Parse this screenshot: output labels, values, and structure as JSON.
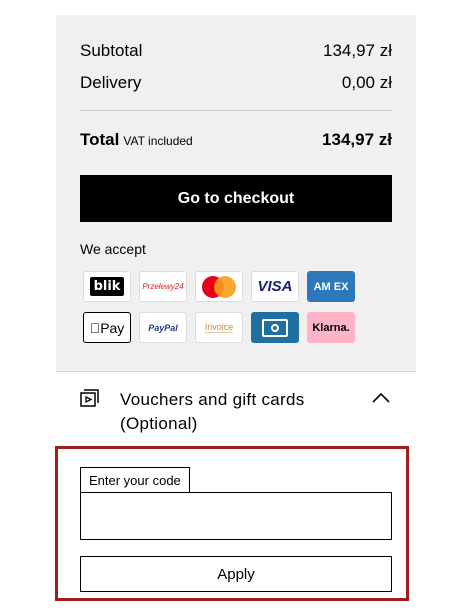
{
  "summary": {
    "subtotal_label": "Subtotal",
    "subtotal_value": "134,97 zł",
    "delivery_label": "Delivery",
    "delivery_value": "0,00 zł",
    "total_label": "Total",
    "total_note": "VAT included",
    "total_value": "134,97 zł"
  },
  "checkout": {
    "button_label": "Go to checkout"
  },
  "payments": {
    "heading": "We accept",
    "methods": [
      {
        "name": "BLIK",
        "text": "blik"
      },
      {
        "name": "Przelewy24",
        "text": "Przelewy24"
      },
      {
        "name": "Mastercard",
        "icon": "mastercard-icon"
      },
      {
        "name": "Visa",
        "text": "VISA"
      },
      {
        "name": "American Express",
        "text": "AM EX"
      },
      {
        "name": "Apple Pay",
        "text": "Pay"
      },
      {
        "name": "PayPal",
        "text": "PayPal"
      },
      {
        "name": "Invoice",
        "text": "Invoice"
      },
      {
        "name": "Cash",
        "icon": "cash-icon"
      },
      {
        "name": "Klarna",
        "text": "Klarna."
      }
    ]
  },
  "vouchers": {
    "title": "Vouchers and gift cards (Optional)",
    "code_label": "Enter your code",
    "code_value": "",
    "apply_label": "Apply"
  },
  "colors": {
    "panel_bg": "#f0f0f0",
    "highlight_border": "#a11c1c",
    "checkout_bg": "#000000"
  }
}
